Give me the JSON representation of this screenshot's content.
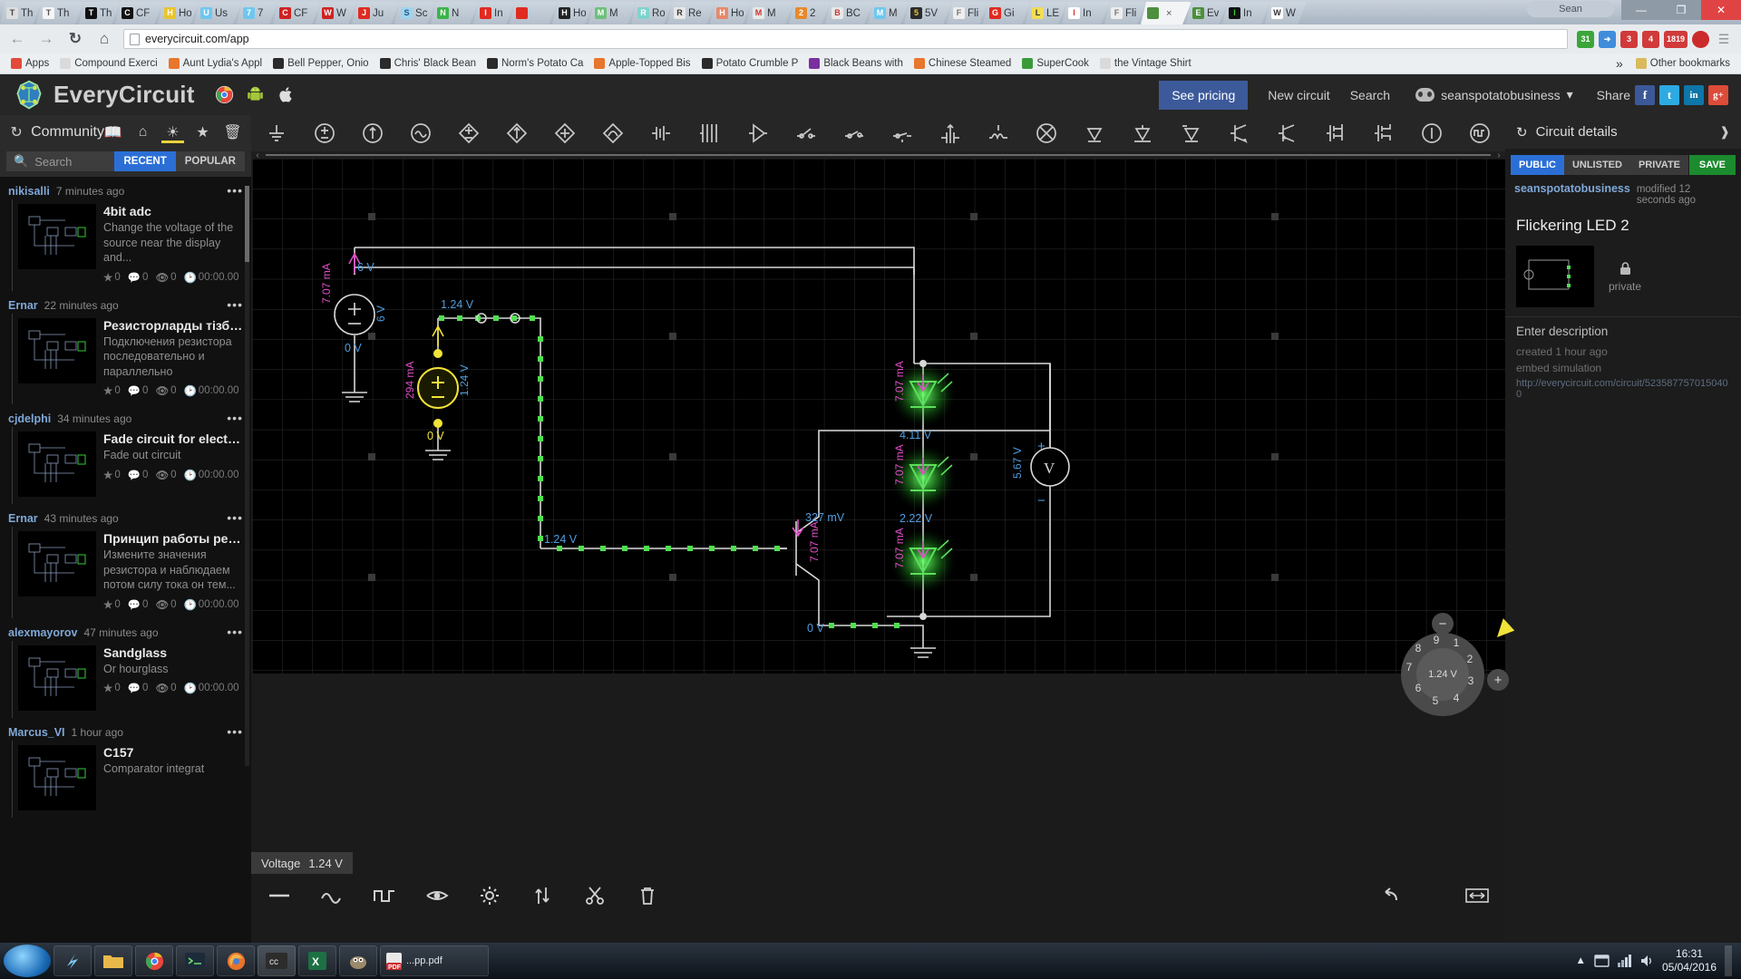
{
  "browser": {
    "tabs": [
      {
        "label": "Th",
        "icon": "doc-icon",
        "color": "#dedede",
        "fg": "#444"
      },
      {
        "label": "Th",
        "icon": "page-icon",
        "color": "#f5f5f5",
        "fg": "#555"
      },
      {
        "label": "Th",
        "icon": "script-icon",
        "color": "#111",
        "fg": "#fff"
      },
      {
        "label": "CF",
        "icon": "letter-a-icon",
        "color": "#111",
        "fg": "#fff"
      },
      {
        "label": "Ho",
        "icon": "spiral-icon",
        "color": "#e8c52c",
        "fg": "#fff"
      },
      {
        "label": "Us",
        "icon": "m-icon",
        "color": "#6fc7ef",
        "fg": "#fff"
      },
      {
        "label": "7",
        "icon": "m-icon",
        "color": "#6fc7ef",
        "fg": "#fff"
      },
      {
        "label": "CF",
        "icon": "n-icon",
        "color": "#cf2222",
        "fg": "#fff"
      },
      {
        "label": "W",
        "icon": "n-icon",
        "color": "#cf2222",
        "fg": "#fff"
      },
      {
        "label": "Ju",
        "icon": "youtube-icon",
        "color": "#e02b20",
        "fg": "#fff"
      },
      {
        "label": "Sc",
        "icon": "sauk-icon",
        "color": "#9fd4ee",
        "fg": "#1b5b86"
      },
      {
        "label": "N",
        "icon": "chart-icon",
        "color": "#3bb44a",
        "fg": "#fff"
      },
      {
        "label": "In",
        "icon": "youtube-icon",
        "color": "#e02b20",
        "fg": "#fff"
      },
      {
        "label": "",
        "icon": "speaker-icon",
        "color": "#e02b20",
        "fg": "#fff"
      },
      {
        "label": "Ho",
        "icon": "pot-icon",
        "color": "#222",
        "fg": "#fff"
      },
      {
        "label": "M",
        "icon": "leaf-icon",
        "color": "#6ec07a",
        "fg": "#fff"
      },
      {
        "label": "Ro",
        "icon": "circle-icon",
        "color": "#7fd3cd",
        "fg": "#fff"
      },
      {
        "label": "Re",
        "icon": "swirl-icon",
        "color": "#e8e8e8",
        "fg": "#333"
      },
      {
        "label": "Ho",
        "icon": "house-icon",
        "color": "#e8886b",
        "fg": "#fff"
      },
      {
        "label": "M",
        "icon": "pin-icon",
        "color": "#e8e8e8",
        "fg": "#c33"
      },
      {
        "label": "2",
        "icon": "swirl2-icon",
        "color": "#e8892c",
        "fg": "#fff"
      },
      {
        "label": "BC",
        "icon": "pin-icon",
        "color": "#e8e8e8",
        "fg": "#c33"
      },
      {
        "label": "M",
        "icon": "m-icon",
        "color": "#6fc7ef",
        "fg": "#fff"
      },
      {
        "label": "5V",
        "icon": "bag-icon",
        "color": "#2b2b2b",
        "fg": "#e8c52c"
      },
      {
        "label": "Fli",
        "icon": "syringe-icon",
        "color": "#eee",
        "fg": "#777"
      },
      {
        "label": "Gi",
        "icon": "youtube-icon",
        "color": "#e02b20",
        "fg": "#fff"
      },
      {
        "label": "LE",
        "icon": "bulb-icon",
        "color": "#f2dd55",
        "fg": "#333"
      },
      {
        "label": "In",
        "icon": "gmail-icon",
        "color": "#fff",
        "fg": "#d33"
      },
      {
        "label": "Fli",
        "icon": "syringe-icon",
        "color": "#eee",
        "fg": "#777"
      },
      {
        "label": "",
        "icon": "everycircuit-icon",
        "color": "#4c8f3e",
        "fg": "#fff",
        "active": true,
        "close": "×"
      },
      {
        "label": "Ev",
        "icon": "everycircuit-icon",
        "color": "#4c8f3e",
        "fg": "#fff"
      },
      {
        "label": "In",
        "icon": "green-circle-icon",
        "color": "#111",
        "fg": "#3c3"
      },
      {
        "label": "W",
        "icon": "w-icon",
        "color": "#fff",
        "fg": "#333"
      }
    ],
    "window_buttons": {
      "minimize": "—",
      "maximize": "❐",
      "close": "✕"
    },
    "search_placeholder": "Sean",
    "url": "everycircuit.com/app",
    "nav": {
      "back": "←",
      "forward": "→",
      "reload": "C",
      "home": "⌂"
    },
    "bookmarks": [
      {
        "label": "Apps",
        "icon": "apps-icon",
        "color": "#e24b3a"
      },
      {
        "label": "Compound Exerci",
        "icon": "page-icon",
        "color": "#dadada"
      },
      {
        "label": "Aunt Lydia's Appl",
        "icon": "blogger-icon",
        "color": "#e8762c"
      },
      {
        "label": "Bell Pepper, Onio",
        "icon": "facebook-round-icon",
        "color": "#2b2b2b"
      },
      {
        "label": "Chris' Black Bean",
        "icon": "facebook-round-icon",
        "color": "#2b2b2b"
      },
      {
        "label": "Norm's Potato Ca",
        "icon": "facebook-round-icon",
        "color": "#2b2b2b"
      },
      {
        "label": "Apple-Topped Bis",
        "icon": "blogger-icon",
        "color": "#e8762c"
      },
      {
        "label": "Potato Crumble P",
        "icon": "facebook-round-icon",
        "color": "#2b2b2b"
      },
      {
        "label": "Black Beans with",
        "icon": "v-icon",
        "color": "#7b2fa0"
      },
      {
        "label": "Chinese Steamed",
        "icon": "blogger-icon",
        "color": "#e8762c"
      },
      {
        "label": "SuperCook",
        "icon": "green-icon",
        "color": "#3a9a3a"
      },
      {
        "label": "the Vintage Shirt",
        "icon": "page-icon",
        "color": "#dadada"
      }
    ],
    "bookmarks_overflow": "»",
    "other_bookmarks": "Other bookmarks"
  },
  "app": {
    "brand": "EveryCircuit",
    "platforms": [
      "chrome-icon",
      "android-icon",
      "apple-icon"
    ],
    "see_pricing": "See pricing",
    "new_circuit": "New circuit",
    "search": "Search",
    "user": "seanspotatobusiness",
    "user_caret": "▾",
    "share": "Share",
    "social": [
      {
        "name": "facebook-icon",
        "glyph": "f",
        "color": "#3b5998"
      },
      {
        "name": "twitter-icon",
        "glyph": "t",
        "color": "#2daae1"
      },
      {
        "name": "linkedin-icon",
        "glyph": "in",
        "color": "#0e76a8"
      },
      {
        "name": "googleplus-icon",
        "glyph": "g+",
        "color": "#dd4b39"
      }
    ]
  },
  "sidebar": {
    "title": "Community",
    "icons": [
      "book-icon",
      "home-icon",
      "globe-icon",
      "bookmark-icon",
      "trash-icon"
    ],
    "selected_icon": "globe-icon",
    "search_placeholder": "Search",
    "tabs": [
      {
        "label": "RECENT",
        "active": true
      },
      {
        "label": "POPULAR",
        "active": false
      }
    ],
    "posts": [
      {
        "author": "nikisalli",
        "time": "7 minutes ago",
        "title": "4bit adc",
        "desc": "Change the voltage of the source near the display and...",
        "stars": "0",
        "comments": "0",
        "views": "0",
        "duration": "00:00.00"
      },
      {
        "author": "Ernar",
        "time": "22 minutes ago",
        "title": "Резисторларды тізбек...",
        "desc": "Подключения резистора последовательно и параллельно",
        "stars": "0",
        "comments": "0",
        "views": "0",
        "duration": "00:00.00"
      },
      {
        "author": "cjdelphi",
        "time": "34 minutes ago",
        "title": "Fade circuit for electro...",
        "desc": "Fade out circuit",
        "stars": "0",
        "comments": "0",
        "views": "0",
        "duration": "00:00.00"
      },
      {
        "author": "Ernar",
        "time": "43 minutes ago",
        "title": "Принцип работы рези...",
        "desc": "Измените значения резистора и наблюдаем потом силу тока он тем...",
        "stars": "0",
        "comments": "0",
        "views": "0",
        "duration": "00:00.00"
      },
      {
        "author": "alexmayorov",
        "time": "47 minutes ago",
        "title": "Sandglass",
        "desc": "Or hourglass",
        "stars": "0",
        "comments": "0",
        "views": "0",
        "duration": "00:00.00"
      },
      {
        "author": "Marcus_VI",
        "time": "1 hour ago",
        "title": "C157",
        "desc": "Comparator integrat",
        "stars": "",
        "comments": "",
        "views": "",
        "duration": ""
      }
    ],
    "dots": "•••"
  },
  "toolbar": {
    "items": [
      "ground-icon",
      "voltage-source-icon",
      "current-source-icon",
      "ac-source-icon",
      "dependent-source-1-icon",
      "dependent-source-2-icon",
      "dependent-source-3-icon",
      "dependent-source-4-icon",
      "signal-icon",
      "resistor-bank-icon",
      "buffer-icon",
      "switch-open-icon",
      "switch-close-icon",
      "relay-icon",
      "potentiometer-icon",
      "inductor-icon",
      "xor-icon",
      "diode-a-icon",
      "diode-b-icon",
      "diode-c-icon",
      "npn-icon",
      "pnp-icon",
      "nmos-icon",
      "pmos-icon",
      "probe-icon",
      "pulse-icon"
    ],
    "scroll_left": "‹",
    "scroll_right": "›"
  },
  "circuit": {
    "name": "Flickering LED 2",
    "labels": {
      "v6": "6 V",
      "i707_src": "7.07 mA",
      "v0_src": "0 V",
      "v6_side": "6 V",
      "v124_top": "1.24 V",
      "i294": "294 mA",
      "v124_side": "1.24 V",
      "v0_cs": "0 V",
      "v124_wire": "1.24 V",
      "v327": "327 mV",
      "i707_q": "7.07 mA",
      "v0_bottom": "0 V",
      "led1_i": "7.07 mA",
      "led1_v": "4.11 V",
      "led2_i": "7.07 mA",
      "led2_v": "2.22 V",
      "led3_i": "7.07 mA",
      "meter_v": "5.67 V",
      "meter_plus": "+",
      "meter_minus": "−"
    }
  },
  "details": {
    "title": "Circuit details",
    "share_icon": "share-icon",
    "visibility": [
      {
        "label": "PUBLIC",
        "active": true
      },
      {
        "label": "UNLISTED",
        "active": false
      },
      {
        "label": "PRIVATE",
        "active": false
      }
    ],
    "save": "SAVE",
    "author": "seanspotatobusiness",
    "modified": "modified 12 seconds ago",
    "circuit_title": "Flickering LED 2",
    "privacy": "private",
    "lock_icon": "lock-icon",
    "description_placeholder": "Enter description",
    "created": "created 1 hour ago",
    "embed": "embed simulation",
    "url": "http://everycircuit.com/circuit/5235877570150400"
  },
  "dial": {
    "value": "1.24 V",
    "numbers": [
      "1",
      "2",
      "3",
      "4",
      "5",
      "6",
      "7",
      "8",
      "9"
    ],
    "minus": "−",
    "plus": "+"
  },
  "bottom": {
    "voltage_label": "Voltage",
    "voltage_value": "1.24 V",
    "tools": [
      "dc-icon",
      "sine-icon",
      "pulse-icon",
      "eye-icon",
      "settings-icon",
      "updown-icon",
      "cut-icon",
      "trash-icon"
    ],
    "undo": "undo-icon",
    "fit": "fit-icon"
  },
  "taskbar": {
    "items": [
      "start-icon",
      "gadget-icon",
      "explorer-icon",
      "chrome-icon",
      "terminal-icon",
      "firefox-icon",
      "cc-icon",
      "excel-icon",
      "gimp-icon",
      "pdf-icon"
    ],
    "window_label": "...pp.pdf",
    "tray": [
      "show-desktop-icon",
      "network-icon",
      "volume-icon"
    ],
    "time": "16:31",
    "date": "05/04/2016"
  }
}
